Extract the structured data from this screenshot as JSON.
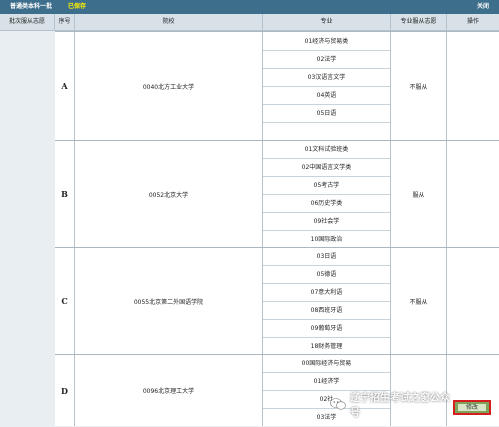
{
  "title_bar": {
    "title": "普通类本科一批",
    "status": "已保存",
    "close": "关闭"
  },
  "columns": {
    "batch": "批次服从志愿",
    "seq": "序号",
    "school": "院校",
    "major": "专业",
    "obey": "专业服从志愿",
    "op": "操作"
  },
  "groups": [
    {
      "seq": "A",
      "school": "0040北方工业大学",
      "obey": "不服从",
      "majors": [
        "01经济与贸易类",
        "02法学",
        "03汉语言文学",
        "04英语",
        "05日语",
        ""
      ]
    },
    {
      "seq": "B",
      "school": "0052北京大学",
      "obey": "服从",
      "majors": [
        "01文科试验班类",
        "02中国语言文学类",
        "05考古学",
        "06历史学类",
        "09社会学",
        "10国际政治"
      ]
    },
    {
      "seq": "C",
      "school": "0055北京第二外国语学院",
      "obey": "不服从",
      "majors": [
        "03日语",
        "05德语",
        "07意大利语",
        "08西班牙语",
        "09葡萄牙语",
        "18财务管理"
      ]
    },
    {
      "seq": "D",
      "school": "0096北京理工大学",
      "obey": "",
      "majors": [
        "00国际经济与贸易",
        "01经济学",
        "02社",
        "03法学"
      ]
    }
  ],
  "modify_button": "修改",
  "watermark": "辽宁招生考试之窗公众号",
  "colors": {
    "title_bar": "#3d6e8c",
    "status_text": "#fff200",
    "header_bg": "#d7e1e7",
    "button_border": "#d21e1e",
    "button_bg": "#7fa35a"
  }
}
